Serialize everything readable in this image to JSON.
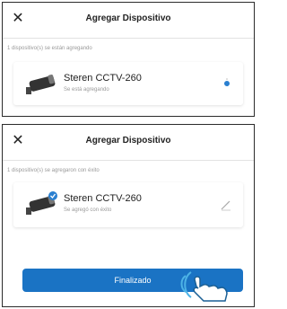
{
  "screen_adding": {
    "title": "Agregar Dispositivo",
    "status": "1 dispositivo(s) se están agregando",
    "device": {
      "name": "Steren CCTV-260",
      "state": "Se está agregando"
    },
    "close_icon": "close-icon",
    "progress_icon": "loading-spinner-icon"
  },
  "screen_added": {
    "title": "Agregar Dispositivo",
    "status": "1 dispositivo(s) se agregaron con éxito",
    "device": {
      "name": "Steren CCTV-260",
      "state": "Se agregó con éxito"
    },
    "close_icon": "close-icon",
    "edit_icon": "edit-icon",
    "done_button": "Finalizado"
  },
  "colors": {
    "accent": "#1a73c4",
    "check_badge": "#2a7fd0",
    "muted_text": "#9a9a9a"
  }
}
